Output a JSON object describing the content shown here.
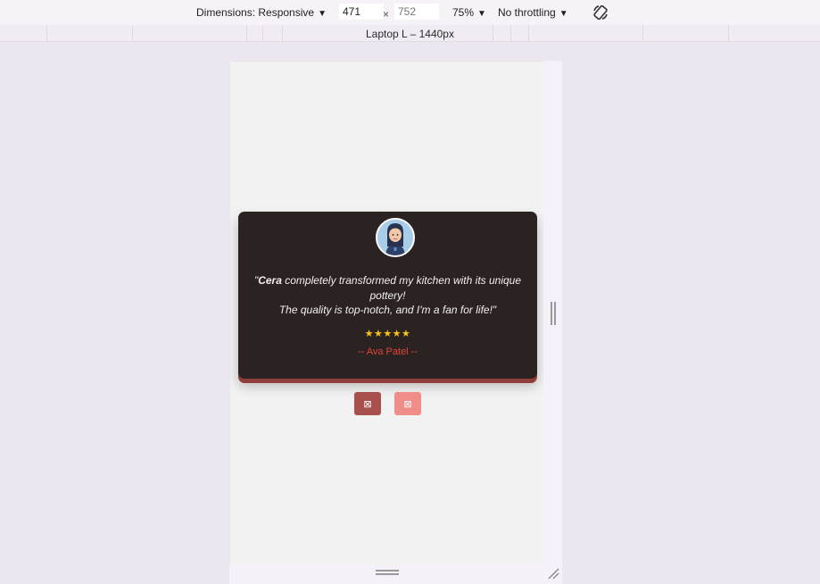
{
  "devtools": {
    "dimensions_label": "Dimensions: Responsive",
    "width_value": "471",
    "height_placeholder": "752",
    "times_sign": "×",
    "zoom_label": "75%",
    "throttling_label": "No throttling",
    "caret": "▼",
    "device_label": "Laptop L – 1440px"
  },
  "testimonial": {
    "quote_open": "\"",
    "brand": "Cera",
    "quote_line1": " completely transformed my kitchen with its unique pottery!",
    "quote_line2": "The quality is top-notch, and I'm a fan for life!\"",
    "stars": "★★★★★",
    "rating": 5,
    "author": "-- Ava Patel --"
  },
  "nav": {
    "prev_glyph": "⊠",
    "next_glyph": "⊠"
  },
  "colors": {
    "card_bg": "#2b2322",
    "card_accent": "#8f3e3a",
    "star_color": "#f7c31a",
    "author_color": "#e0433b",
    "prev_button": "#a8504c",
    "next_button": "#ef8d88"
  },
  "icons": {
    "rotate": "rotate-icon",
    "avatar": "avatar-image"
  }
}
